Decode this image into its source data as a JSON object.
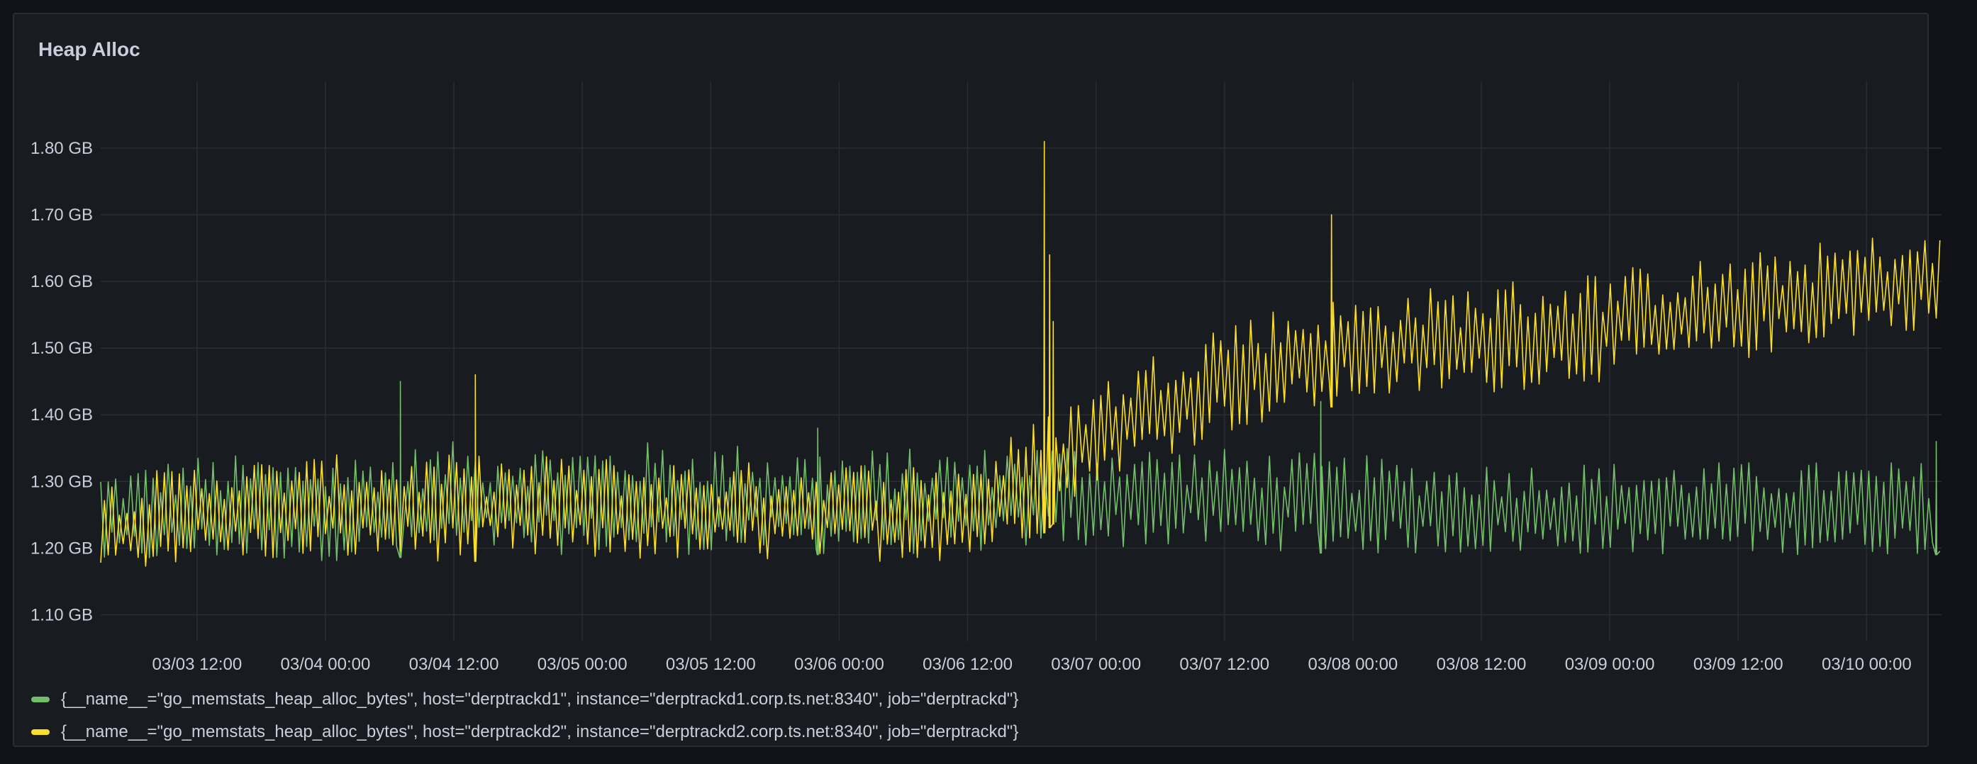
{
  "panel": {
    "title": "Heap Alloc"
  },
  "chart_data": {
    "type": "line",
    "title": "Heap Alloc",
    "xlabel": "",
    "ylabel": "",
    "yunit": "GB",
    "ylim": [
      1.06,
      1.9
    ],
    "yticks": [
      1.1,
      1.2,
      1.3,
      1.4,
      1.5,
      1.6,
      1.7,
      1.8
    ],
    "ytick_labels": [
      "1.10 GB",
      "1.20 GB",
      "1.30 GB",
      "1.40 GB",
      "1.50 GB",
      "1.60 GB",
      "1.70 GB",
      "1.80 GB"
    ],
    "xlim": [
      "2024-03-03 03:00",
      "2024-03-10 07:00"
    ],
    "xticks": [
      "2024-03-03 12:00",
      "2024-03-04 00:00",
      "2024-03-04 12:00",
      "2024-03-05 00:00",
      "2024-03-05 12:00",
      "2024-03-06 00:00",
      "2024-03-06 12:00",
      "2024-03-07 00:00",
      "2024-03-07 12:00",
      "2024-03-08 00:00",
      "2024-03-08 12:00",
      "2024-03-09 00:00",
      "2024-03-09 12:00",
      "2024-03-10 00:00"
    ],
    "xtick_labels": [
      "03/03 12:00",
      "03/04 00:00",
      "03/04 12:00",
      "03/05 00:00",
      "03/05 12:00",
      "03/06 00:00",
      "03/06 12:00",
      "03/07 00:00",
      "03/07 12:00",
      "03/08 00:00",
      "03/08 12:00",
      "03/09 00:00",
      "03/09 12:00",
      "03/10 00:00"
    ],
    "grid": true,
    "legend_position": "bottom",
    "series": [
      {
        "name": "{__name__=\"go_memstats_heap_alloc_bytes\", host=\"derptrackd1\", instance=\"derptrackd1.corp.ts.net:8340\", job=\"derptrackd\"}",
        "color": "#73bf69",
        "x": [
          "03/03 03:00",
          "03/03 12:00",
          "03/04 00:00",
          "03/04 12:00",
          "03/05 00:00",
          "03/05 12:00",
          "03/06 00:00",
          "03/06 12:00",
          "03/06 19:00",
          "03/07 00:00",
          "03/07 12:00",
          "03/08 00:00",
          "03/08 12:00",
          "03/09 00:00",
          "03/09 12:00",
          "03/10 00:00",
          "03/10 07:00"
        ],
        "low": [
          1.17,
          1.18,
          1.18,
          1.19,
          1.19,
          1.19,
          1.19,
          1.19,
          1.2,
          1.2,
          1.2,
          1.19,
          1.19,
          1.19,
          1.19,
          1.19,
          1.19
        ],
        "high": [
          1.32,
          1.34,
          1.34,
          1.36,
          1.36,
          1.36,
          1.35,
          1.35,
          1.36,
          1.36,
          1.35,
          1.34,
          1.33,
          1.33,
          1.33,
          1.33,
          1.33
        ],
        "spikes": [
          [
            "03/04 07:00",
            1.45
          ],
          [
            "03/05 22:00",
            1.38
          ],
          [
            "03/07 21:00",
            1.42
          ],
          [
            "03/10 06:30",
            1.36
          ]
        ]
      },
      {
        "name": "{__name__=\"go_memstats_heap_alloc_bytes\", host=\"derptrackd2\", instance=\"derptrackd2.corp.ts.net:8340\", job=\"derptrackd\"}",
        "color": "#fade2a",
        "x": [
          "03/03 03:00",
          "03/03 12:00",
          "03/04 00:00",
          "03/04 12:00",
          "03/05 00:00",
          "03/05 12:00",
          "03/06 00:00",
          "03/06 12:00",
          "03/06 19:00",
          "03/07 00:00",
          "03/07 12:00",
          "03/08 00:00",
          "03/08 12:00",
          "03/09 00:00",
          "03/09 12:00",
          "03/10 00:00",
          "03/10 07:00"
        ],
        "low": [
          1.16,
          1.18,
          1.18,
          1.18,
          1.18,
          1.18,
          1.18,
          1.18,
          1.22,
          1.3,
          1.37,
          1.42,
          1.43,
          1.45,
          1.48,
          1.52,
          1.53
        ],
        "high": [
          1.3,
          1.33,
          1.34,
          1.34,
          1.34,
          1.33,
          1.33,
          1.33,
          1.4,
          1.45,
          1.55,
          1.58,
          1.6,
          1.62,
          1.64,
          1.67,
          1.67
        ],
        "spikes": [
          [
            "03/06 19:10",
            1.81
          ],
          [
            "03/06 19:40",
            1.64
          ],
          [
            "03/06 20:00",
            1.54
          ],
          [
            "03/04 14:00",
            1.46
          ],
          [
            "03/07 22:00",
            1.7
          ]
        ]
      }
    ]
  }
}
